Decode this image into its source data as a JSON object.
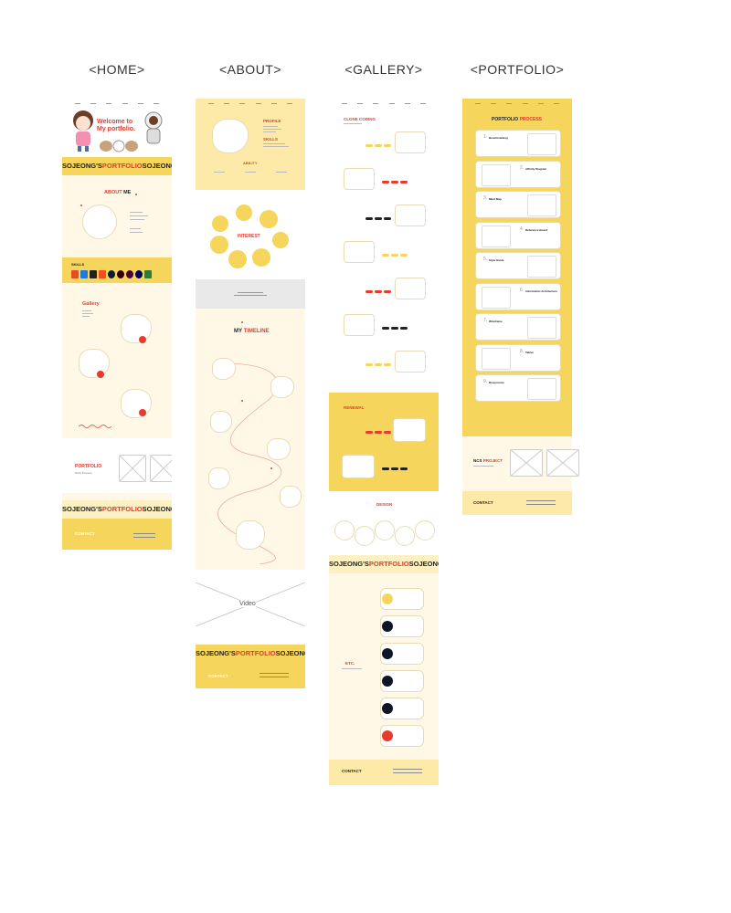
{
  "columns": [
    {
      "title": "<HOME>"
    },
    {
      "title": "<ABOUT>"
    },
    {
      "title": "<GALLERY>"
    },
    {
      "title": "<PORTFOLIO>"
    }
  ],
  "home": {
    "hero_line1": "Welcome to",
    "hero_line2a": "My ",
    "hero_line2b": "portfolio.",
    "marquee_a": "SOJEONG'S",
    "marquee_b": "PORTFOLIO",
    "about_title_a": "ABOUT",
    "about_title_b": " ME",
    "skills_title": "SKILLS",
    "gallery_title": "Gallery",
    "portfolio_title": "PORTFOLIO",
    "portfolio_sub": "Work Process",
    "contact_title": "CONTACT"
  },
  "about": {
    "profile_title": "PROFILE",
    "skills_title": "SKILLS",
    "ability_title": "ABILITY",
    "interest_title": "INTEREST",
    "timeline_title_a": "MY ",
    "timeline_title_b": "TIMELINE",
    "video_label": "Video",
    "marquee_a": "SOJEONG'S",
    "marquee_b": "PORTFOLIO",
    "contact_title": "CONTACT"
  },
  "gallery": {
    "clone_title": "CLONE CODING",
    "renewal_title": "RENEWAL",
    "design_title": "DESIGN",
    "etc_title": "ETC.",
    "marquee_a": "SOJEONG'S",
    "marquee_b": "PORTFOLIO",
    "contact_title": "CONTACT"
  },
  "portfolio": {
    "process_title_a": "PORTFOLIO ",
    "process_title_b": "PROCESS",
    "steps": [
      {
        "num": "1.",
        "label": "Benchmarking"
      },
      {
        "num": "2.",
        "label": "Affinity Diagram"
      },
      {
        "num": "3.",
        "label": "Mind Map"
      },
      {
        "num": "4.",
        "label": "Reference Board"
      },
      {
        "num": "5.",
        "label": "Style Guide"
      },
      {
        "num": "6.",
        "label": "Information Architecture"
      },
      {
        "num": "7.",
        "label": "Wireframe"
      },
      {
        "num": "8.",
        "label": "Tablet"
      },
      {
        "num": "9.",
        "label": "Responsive"
      }
    ],
    "ncs_title_a": "NCS ",
    "ncs_title_b": "PROJECT",
    "contact_title": "CONTACT"
  },
  "colors": {
    "yellow": "#f6d55c",
    "red": "#e63b2e",
    "cream": "#fff8e6",
    "dark": "#222222"
  }
}
